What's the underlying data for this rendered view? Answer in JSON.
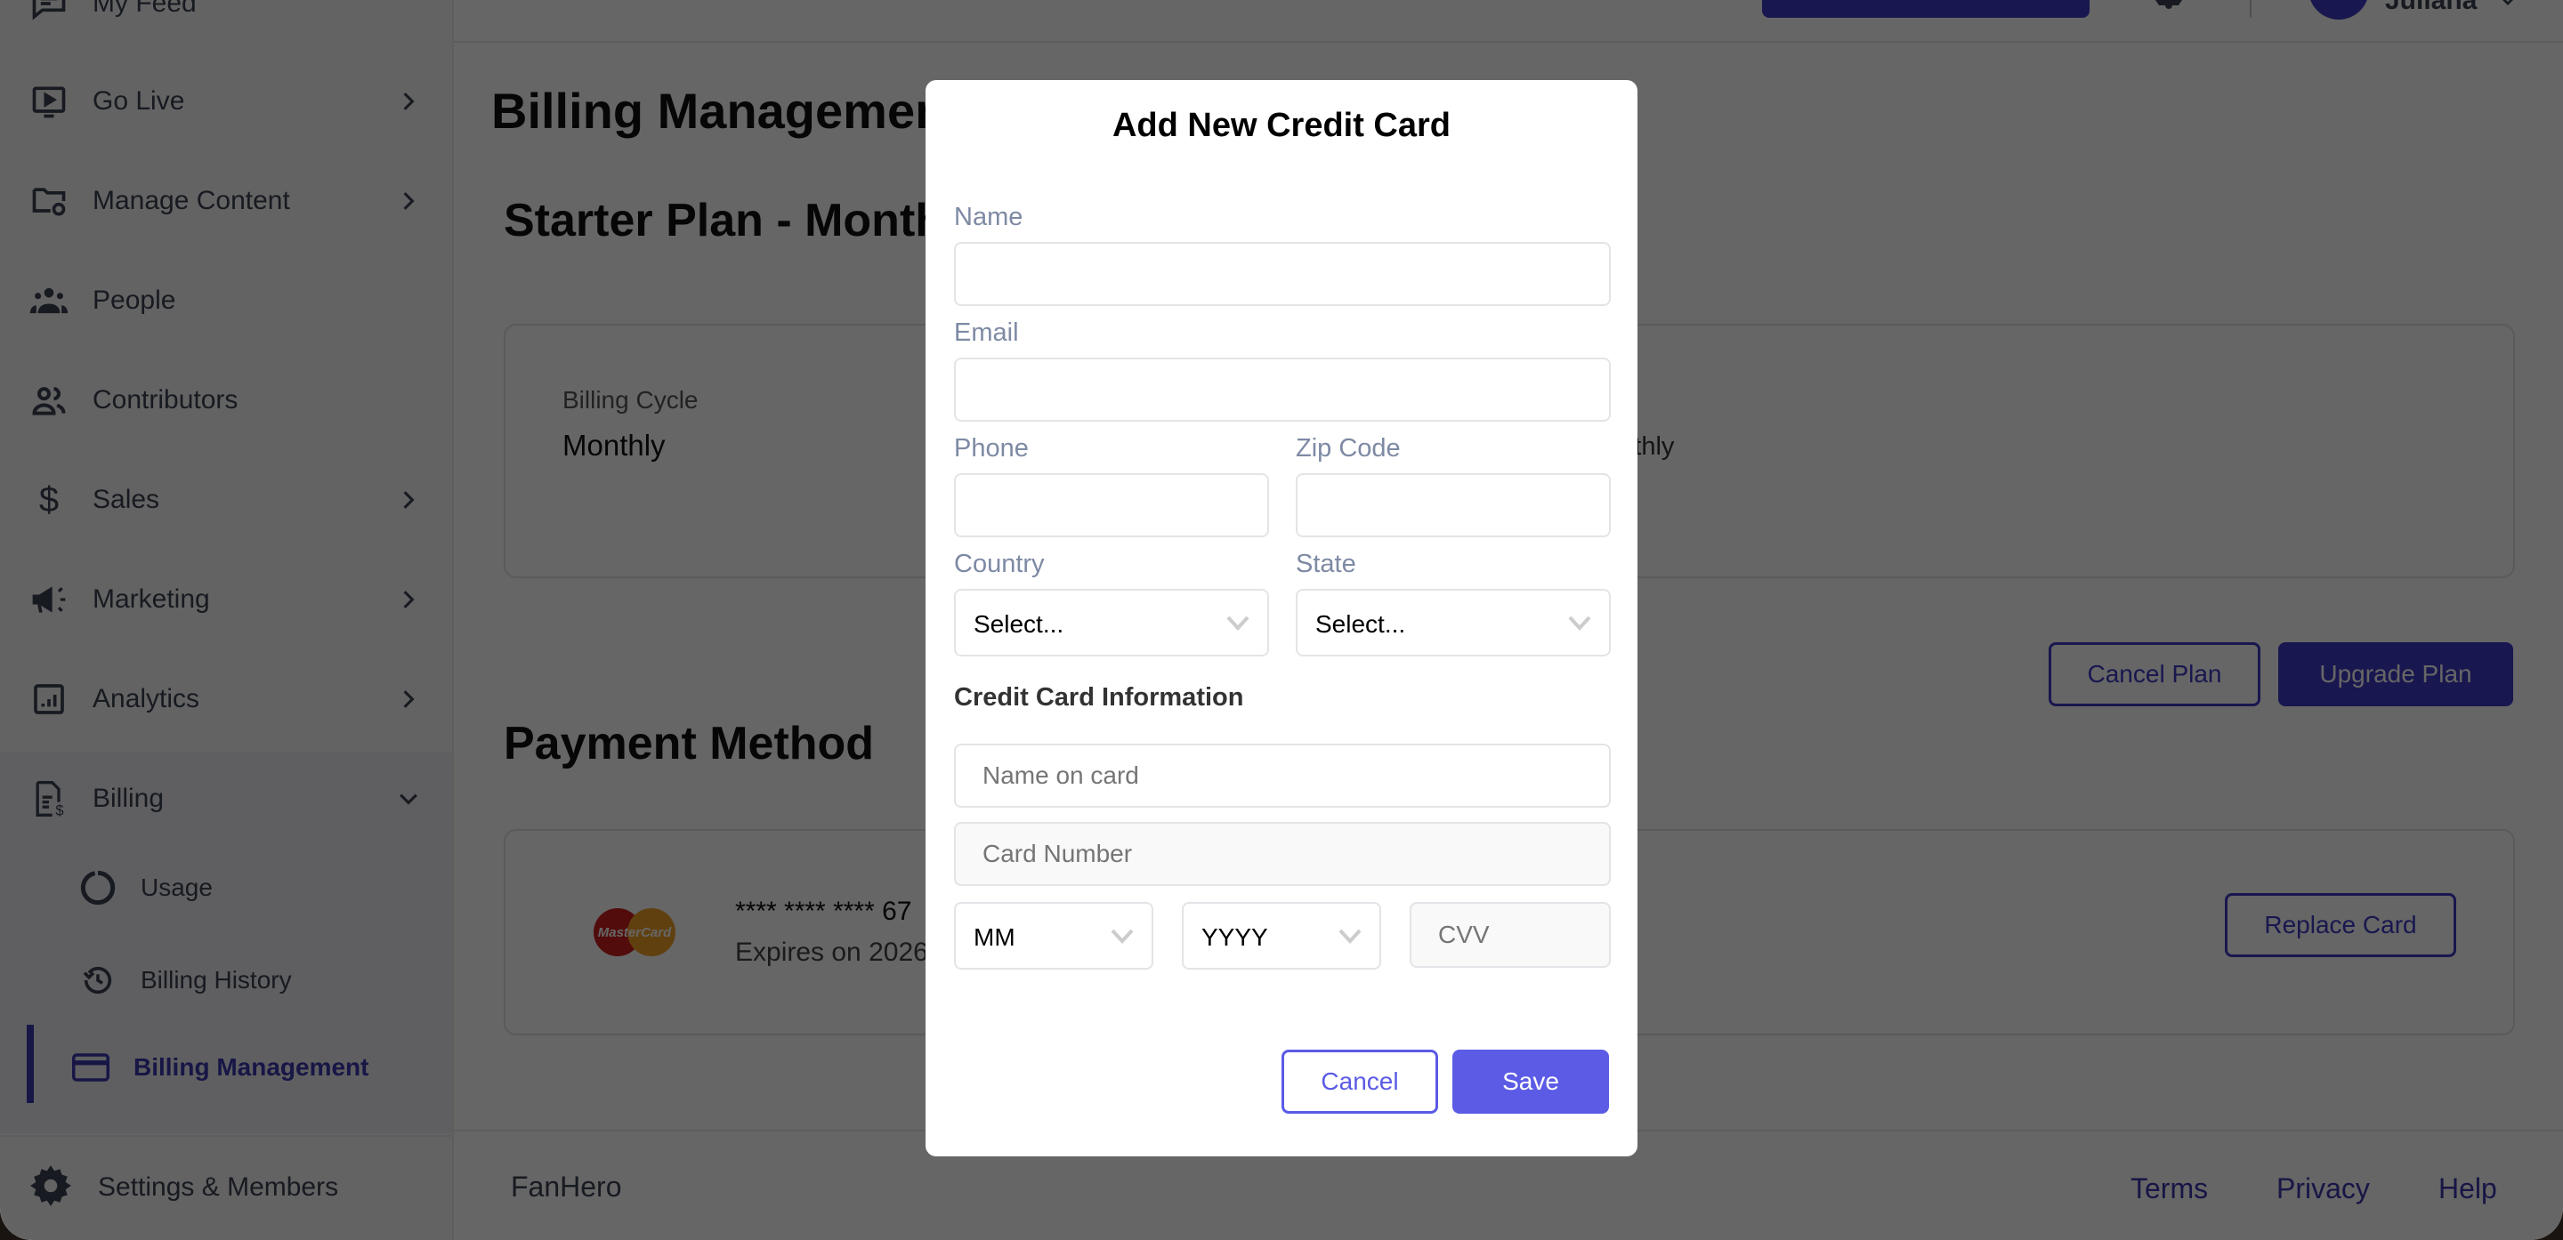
{
  "sidebar": {
    "items": [
      {
        "label": "My Feed",
        "icon": "chat-icon"
      },
      {
        "label": "Go Live",
        "icon": "play-screen-icon"
      },
      {
        "label": "Manage Content",
        "icon": "folder-gear-icon"
      },
      {
        "label": "People",
        "icon": "people-icon"
      },
      {
        "label": "Contributors",
        "icon": "contributors-icon"
      },
      {
        "label": "Sales",
        "icon": "dollar-icon"
      },
      {
        "label": "Marketing",
        "icon": "megaphone-icon"
      },
      {
        "label": "Analytics",
        "icon": "bar-chart-icon"
      },
      {
        "label": "Billing",
        "icon": "invoice-dollar-icon"
      }
    ],
    "billing_sub": [
      {
        "label": "Usage",
        "icon": "donut-icon"
      },
      {
        "label": "Billing History",
        "icon": "history-icon"
      },
      {
        "label": "Billing Management",
        "icon": "credit-card-icon",
        "active": true
      }
    ],
    "settings_label": "Settings & Members"
  },
  "header": {
    "username": "Juliana"
  },
  "main": {
    "page_title": "Billing Management",
    "plan_title": "Starter Plan - Monthly",
    "plan": {
      "billing_cycle_label": "Billing Cycle",
      "billing_cycle_value": "Monthly",
      "partial_value": "onthly"
    },
    "cancel_plan_label": "Cancel Plan",
    "upgrade_plan_label": "Upgrade Plan",
    "payment_title": "Payment Method",
    "card": {
      "brand": "MasterCard",
      "masked_number": "**** **** ****  67",
      "expires": "Expires on 2026",
      "replace_label": "Replace Card"
    }
  },
  "footer": {
    "brand": "FanHero",
    "links": [
      "Terms",
      "Privacy",
      "Help"
    ]
  },
  "modal": {
    "title": "Add New Credit Card",
    "name_label": "Name",
    "name_value": "",
    "email_label": "Email",
    "email_value": "",
    "phone_label": "Phone",
    "phone_value": "",
    "zip_label": "Zip Code",
    "zip_value": "",
    "country_label": "Country",
    "country_value": "Select...",
    "state_label": "State",
    "state_value": "Select...",
    "cc_section": "Credit Card Information",
    "name_on_card_placeholder": "Name on card",
    "card_number_placeholder": "Card Number",
    "month_value": "MM",
    "year_value": "YYYY",
    "cvv_placeholder": "CVV",
    "cancel_label": "Cancel",
    "save_label": "Save"
  },
  "colors": {
    "accent": "#3e3ac6",
    "modal_accent": "#5b5be6",
    "label": "#7e8aa4"
  }
}
